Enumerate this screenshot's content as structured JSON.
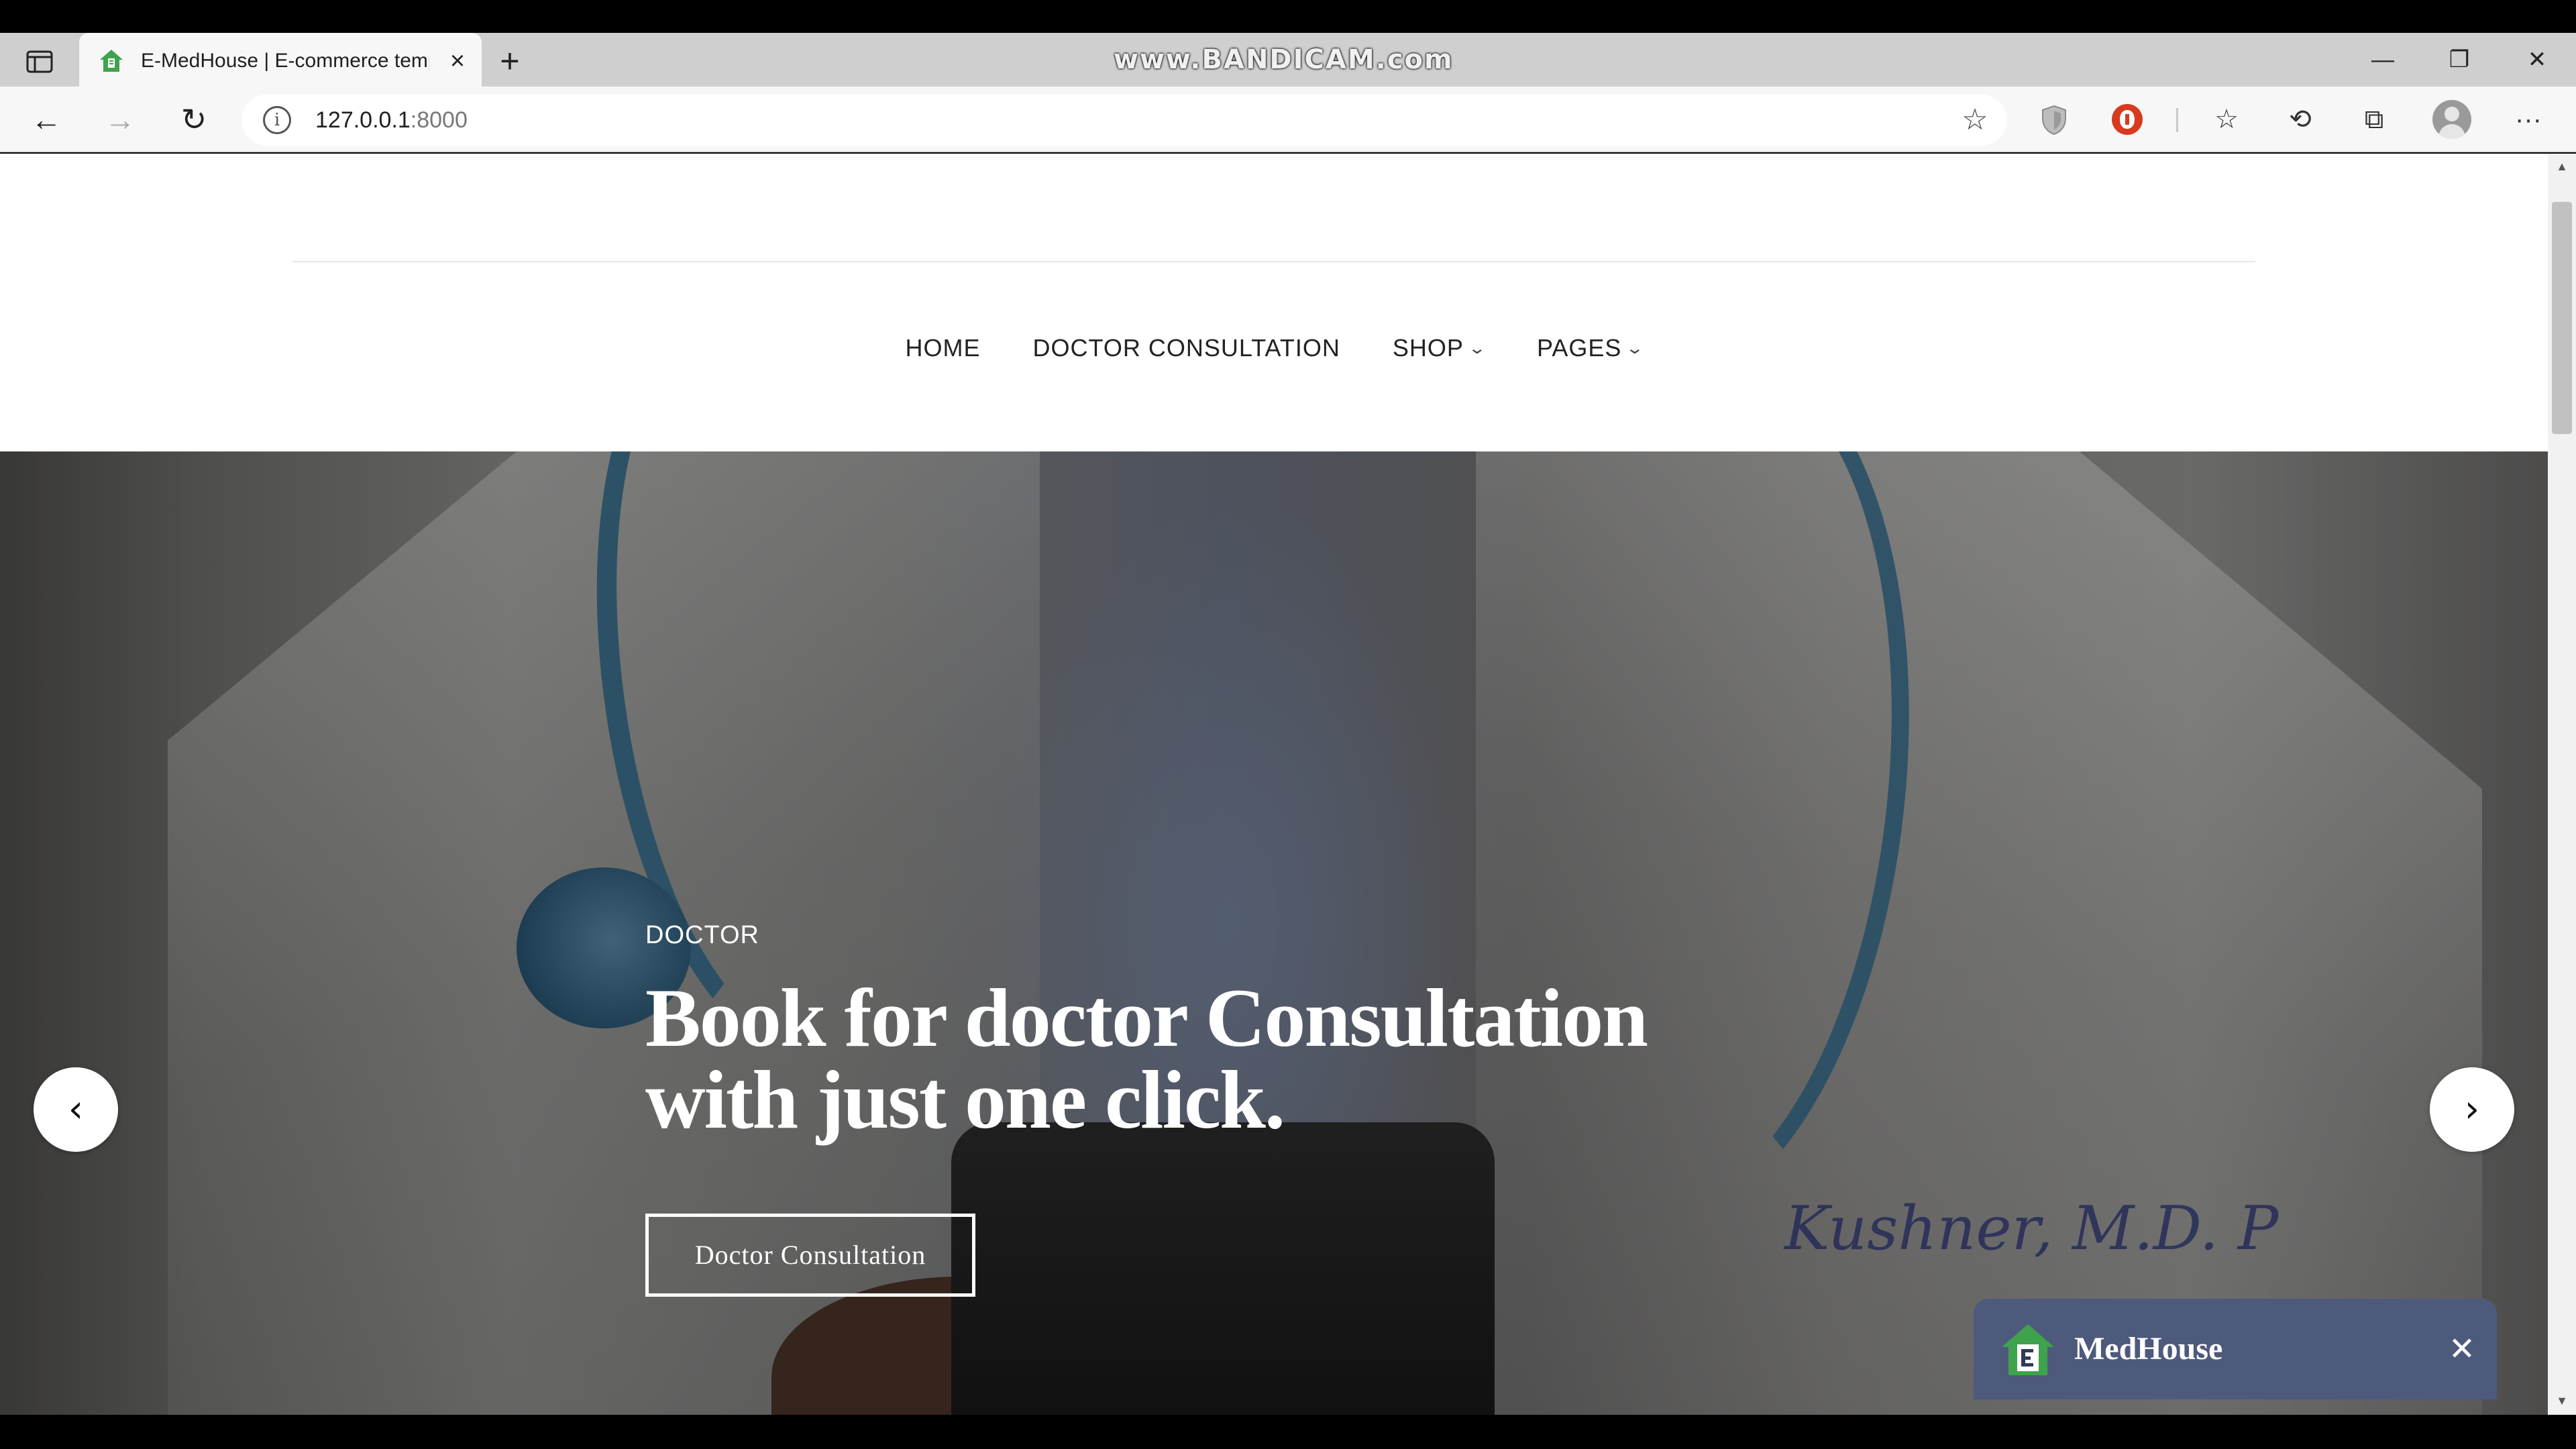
{
  "recorder_watermark": "www.BANDICAM.com",
  "browser": {
    "tab": {
      "title": "E-MedHouse | E-commerce temp",
      "close_icon": "×"
    },
    "new_tab_icon": "+",
    "window_controls": {
      "minimize": "—",
      "restore": "❐",
      "close": "✕"
    },
    "toolbar": {
      "back_icon": "←",
      "forward_icon": "→",
      "refresh_icon": "↻",
      "url_host": "127.0.0.1",
      "url_port": ":8000",
      "favorites_add_icon": "☆",
      "favorites_icon": "☆",
      "history_icon": "⟲",
      "collections_icon": "⧉",
      "more_icon": "···"
    }
  },
  "site": {
    "nav": {
      "home": "HOME",
      "doctor_consultation": "DOCTOR CONSULTATION",
      "shop": "SHOP",
      "pages": "PAGES",
      "chevron": "⌄"
    },
    "hero": {
      "kicker": "DOCTOR",
      "title_line1": "Book for doctor Consultation",
      "title_line2": "with just one click.",
      "button": "Doctor Consultation",
      "prev_icon": "‹",
      "next_icon": "›"
    },
    "chat_widget": {
      "brand": "MedHouse",
      "close_icon": "✕"
    }
  },
  "colors": {
    "chat_widget_bg": "#4e5a7c",
    "brand_green": "#3fa34d",
    "ext_red": "#d73a1e"
  }
}
